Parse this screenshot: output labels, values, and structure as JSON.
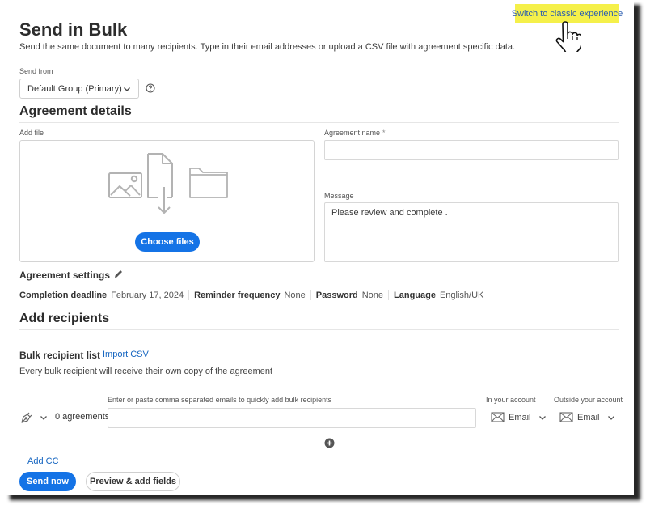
{
  "header": {
    "classic_link": "Switch to classic experience",
    "title": "Send in Bulk",
    "subtitle": "Send the same document to many recipients. Type in their email addresses or upload a CSV file with agreement specific data."
  },
  "send_from": {
    "label": "Send from",
    "selected": "Default Group (Primary)"
  },
  "agreement_details": {
    "heading": "Agreement details",
    "add_file_label": "Add file",
    "choose_files": "Choose files",
    "agreement_name_label": "Agreement name",
    "required_marker": "*",
    "agreement_name_value": "",
    "message_label": "Message",
    "message_value": "Please review and complete  ."
  },
  "agreement_settings": {
    "heading": "Agreement settings",
    "items": [
      {
        "key": "Completion deadline",
        "value": "February 17, 2024"
      },
      {
        "key": "Reminder frequency",
        "value": "None"
      },
      {
        "key": "Password",
        "value": "None"
      },
      {
        "key": "Language",
        "value": "English/UK"
      }
    ]
  },
  "recipients": {
    "heading": "Add recipients",
    "bulk_heading": "Bulk recipient list",
    "import_csv": "Import CSV",
    "note": "Every bulk recipient will receive their own copy of the agreement",
    "emails_label": "Enter or paste comma separated emails to quickly add bulk recipients",
    "emails_value": "",
    "agreements_count": "0 agreements",
    "in_account_label": "In your account",
    "in_account_method": "Email",
    "outside_account_label": "Outside your account",
    "outside_account_method": "Email"
  },
  "footer": {
    "add_cc": "Add CC",
    "send_now": "Send now",
    "preview": "Preview & add fields"
  },
  "colors": {
    "accent": "#1473e6",
    "link": "#1565c0",
    "highlight": "#f5f04a"
  }
}
